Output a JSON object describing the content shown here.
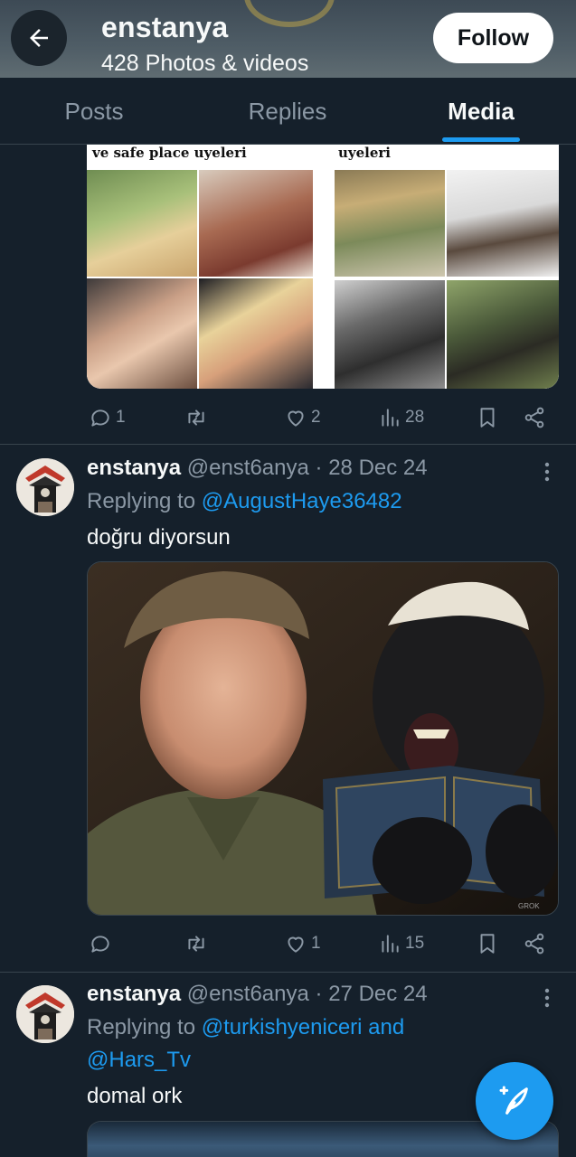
{
  "header": {
    "name": "enstanya",
    "count": "428 Photos & videos",
    "follow_label": "Follow"
  },
  "tabs": [
    {
      "label": "Posts",
      "active": false
    },
    {
      "label": "Replies",
      "active": false
    },
    {
      "label": "Media",
      "active": true
    }
  ],
  "post1": {
    "collage_left_caption": "ve safe place uyeleri",
    "collage_right_caption": "uyeleri",
    "replies": "1",
    "likes": "2",
    "views": "28"
  },
  "post2": {
    "name": "enstanya",
    "handle": "@enst6anya",
    "date": "28 Dec 24",
    "replying_prefix": "Replying to ",
    "replying_to": "@AugustHaye36482",
    "text": "doğru diyorsun",
    "image_watermark": "GROK",
    "replies": "",
    "likes": "1",
    "views": "15"
  },
  "post3": {
    "name": "enstanya",
    "handle": "@enst6anya",
    "date": "27 Dec 24",
    "replying_prefix": "Replying to ",
    "replying_to_1": "@turkishyeniceri",
    "replying_and": " and",
    "replying_to_2": "@Hars_Tv",
    "text": "domal ork"
  },
  "colors": {
    "background": "#15202b",
    "accent": "#1d9bf0",
    "muted": "#8b98a5",
    "divider": "#38444d"
  },
  "icons": [
    "back-arrow-icon",
    "reply-icon",
    "retweet-icon",
    "like-icon",
    "views-icon",
    "bookmark-icon",
    "share-icon",
    "more-icon",
    "compose-icon"
  ]
}
